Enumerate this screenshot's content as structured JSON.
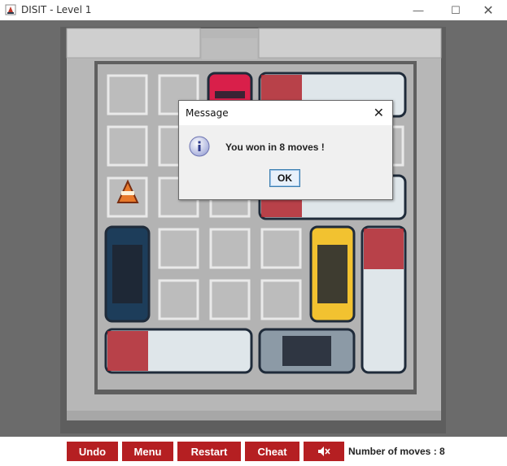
{
  "window": {
    "title": "DISIT - Level 1",
    "minimize_icon": "minimize-icon",
    "maximize_icon": "maximize-icon",
    "close_icon": "close-icon"
  },
  "toolbar": {
    "undo_label": "Undo",
    "menu_label": "Menu",
    "restart_label": "Restart",
    "cheat_label": "Cheat",
    "sound_icon": "speaker-muted-icon",
    "moves_text": "Number of moves : 8",
    "button_color": "#b51f22"
  },
  "dialog": {
    "title": "Message",
    "message": "You won in 8 moves !",
    "ok_label": "OK",
    "close_glyph": "✕",
    "icon": "info-icon"
  },
  "board": {
    "grid_columns": 6,
    "grid_rows": 6,
    "vehicles": [
      {
        "name": "red-car",
        "col": 2,
        "row": 0,
        "length": 1,
        "orientation": "v",
        "color": "#d91f4a"
      },
      {
        "name": "white-truck-top",
        "col": 3,
        "row": 0,
        "length": 3,
        "orientation": "h",
        "color": "#dfe6ea"
      },
      {
        "name": "cone",
        "col": 0,
        "row": 2,
        "length": 1,
        "orientation": "v",
        "color": "#e8792a"
      },
      {
        "name": "white-truck-mid",
        "col": 3,
        "row": 2,
        "length": 3,
        "orientation": "h",
        "color": "#dfe6ea"
      },
      {
        "name": "police-car",
        "col": 0,
        "row": 3,
        "length": 2,
        "orientation": "v",
        "color": "#1d3d5a"
      },
      {
        "name": "yellow-taxi",
        "col": 4,
        "row": 3,
        "length": 2,
        "orientation": "v",
        "color": "#f2c230"
      },
      {
        "name": "white-truck-right",
        "col": 5,
        "row": 3,
        "length": 3,
        "orientation": "v",
        "color": "#dfe6ea"
      },
      {
        "name": "white-truck-bottom",
        "col": 0,
        "row": 5,
        "length": 3,
        "orientation": "h",
        "color": "#dfe6ea"
      },
      {
        "name": "grey-car",
        "col": 3,
        "row": 5,
        "length": 2,
        "orientation": "h",
        "color": "#8c9aa6"
      }
    ]
  }
}
